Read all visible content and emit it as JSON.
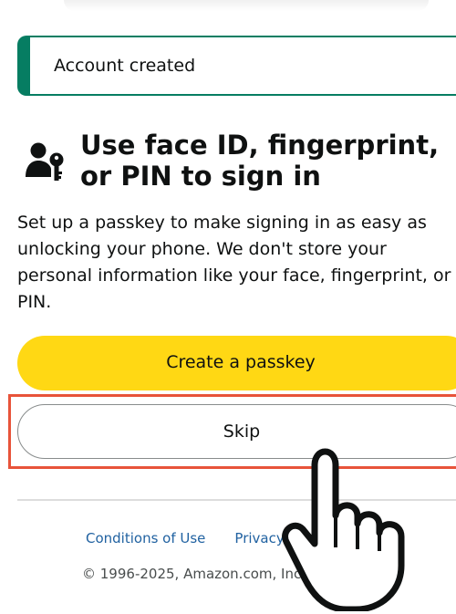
{
  "alert": {
    "message": "Account created",
    "accent_color": "#067d62"
  },
  "heading": {
    "icon": "passkey-user-key-icon",
    "title": "Use face ID, fingerprint, or PIN to sign in"
  },
  "description": "Set up a passkey to make signing in as easy as unlocking your phone. We don't store your personal information like your face, fingerprint, or PIN.",
  "buttons": {
    "primary_label": "Create a passkey",
    "primary_color": "#ffd814",
    "secondary_label": "Skip"
  },
  "annotation": {
    "highlight_color": "#e8533a",
    "cursor_icon": "hand-pointer-icon"
  },
  "footer": {
    "links": [
      "Conditions of Use",
      "Privacy N"
    ],
    "copyright": "© 1996-2025, Amazon.com, Inc. or its"
  }
}
